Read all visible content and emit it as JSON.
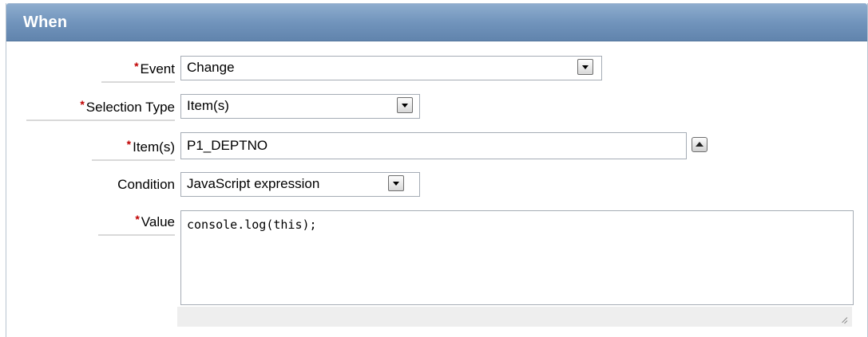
{
  "region": {
    "title": "When"
  },
  "form": {
    "required_marker": "*",
    "event": {
      "label": "Event",
      "value": "Change"
    },
    "selection_type": {
      "label": "Selection Type",
      "value": "Item(s)"
    },
    "items": {
      "label": "Item(s)",
      "value": "P1_DEPTNO"
    },
    "condition": {
      "label": "Condition",
      "value": "JavaScript expression"
    },
    "value": {
      "label": "Value",
      "value": "console.log(this);"
    }
  },
  "icons": {
    "dropdown": "chevron-down-icon",
    "popup": "chevron-up-icon",
    "resize": "resize-grip-icon"
  },
  "colors": {
    "header_bg": "#7194bc",
    "header_text": "#ffffff",
    "required": "#c00000"
  }
}
